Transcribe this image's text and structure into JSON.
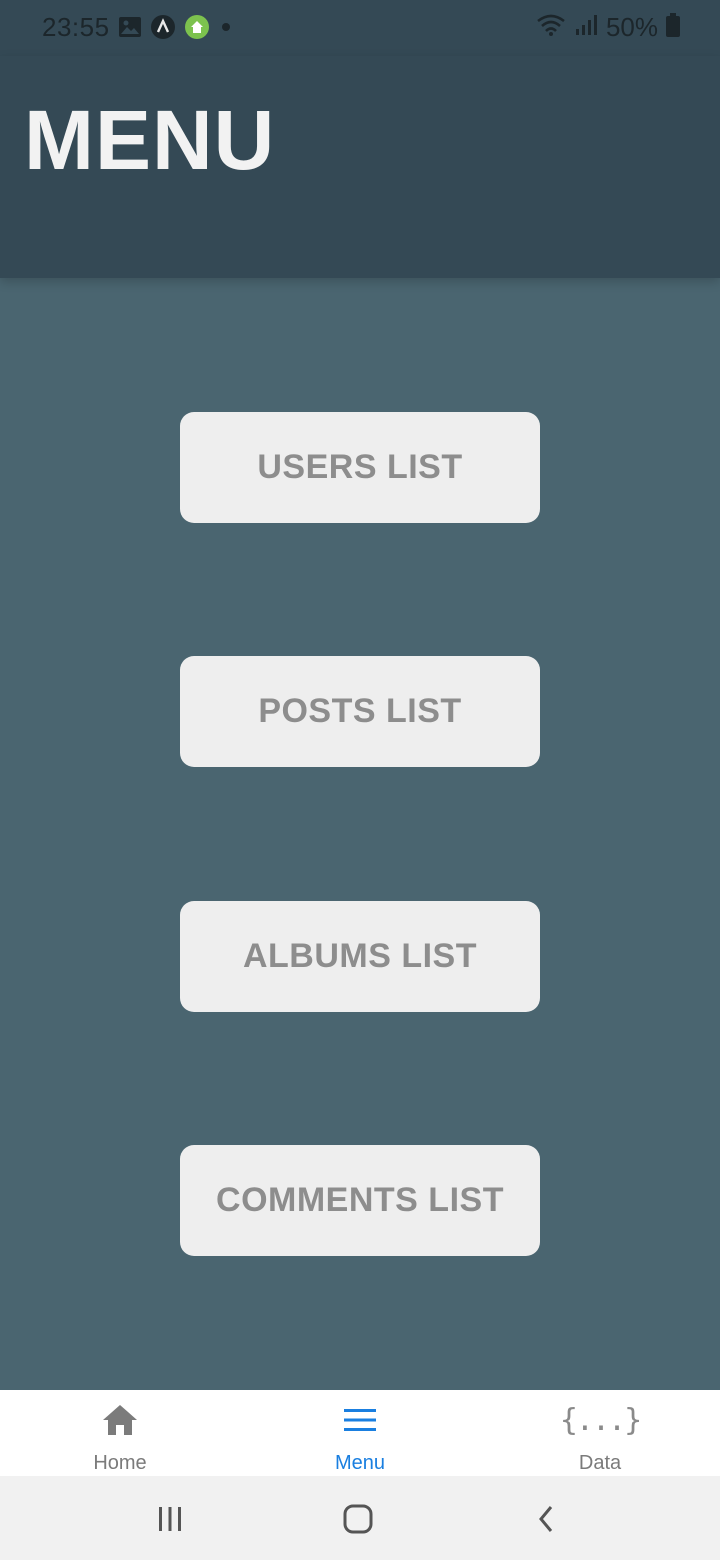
{
  "status_bar": {
    "time": "23:55",
    "battery": "50%",
    "icons_left": [
      "gallery-icon",
      "a-icon",
      "home-app-icon",
      "dot-icon"
    ],
    "icons_right": [
      "wifi-icon",
      "signal-icon",
      "battery-icon"
    ]
  },
  "header": {
    "title": "MENU"
  },
  "menu": {
    "buttons": [
      {
        "label": "USERS LIST"
      },
      {
        "label": "POSTS LIST"
      },
      {
        "label": "ALBUMS LIST"
      },
      {
        "label": "COMMENTS LIST"
      }
    ]
  },
  "tabs": [
    {
      "label": "Home",
      "icon": "home-icon",
      "active": false
    },
    {
      "label": "Menu",
      "icon": "menu-icon",
      "active": true
    },
    {
      "label": "Data",
      "icon": "braces-icon",
      "active": false,
      "glyph": "{...}"
    }
  ],
  "colors": {
    "header_bg": "#344955",
    "body_bg": "#4a6570",
    "button_bg": "#eeeeee",
    "button_text": "#8d8d8d",
    "active_tab": "#1a7fe0",
    "inactive_tab": "#7b7b7b"
  },
  "system_nav": [
    "recent-apps-icon",
    "home-button-icon",
    "back-icon"
  ]
}
